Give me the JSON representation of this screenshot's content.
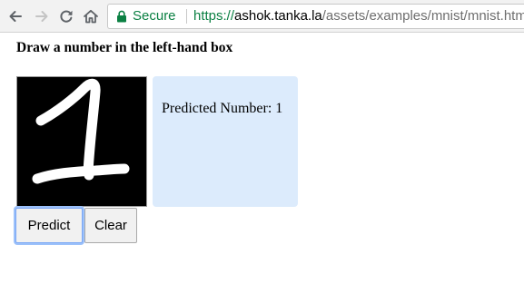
{
  "browser": {
    "secure_label": "Secure",
    "url_scheme": "https://",
    "url_host": "ashok.tanka.la",
    "url_path": "/assets/examples/mnist/mnist.html",
    "icons": {
      "back": "back-arrow-icon",
      "forward": "forward-arrow-icon",
      "reload": "reload-icon",
      "home": "home-icon",
      "lock": "lock-icon"
    },
    "colors": {
      "secure": "#0b8043"
    }
  },
  "page": {
    "heading": "Draw a number in the left-hand box",
    "result": {
      "label": "Predicted Number:",
      "value": "1",
      "text": "Predicted Number: 1"
    },
    "buttons": {
      "predict": "Predict",
      "clear": "Clear"
    },
    "colors": {
      "canvas_background": "#000000",
      "stroke": "#ffffff",
      "result_background": "#dcebfc",
      "focus_ring": "#9cc1fa"
    }
  }
}
